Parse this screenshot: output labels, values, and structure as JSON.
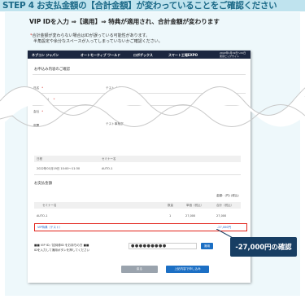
{
  "header": {
    "title": "STEP 4 お支払金額の【合計金額】が変わっていることをご確認ください",
    "bg_color": "#bfe3ee",
    "text_color": "#1c6a88"
  },
  "instruction": {
    "main": "VIP IDを入力 ⇒【適用】⇒ 特典が適用され、合計金額が変わります",
    "note_mark": "*",
    "note1": "合計金額が変わらない場合はIDが誤っている可能性があります。",
    "note2": "半角設定や余分なスペースが入ってしまっていないかご確認ください。"
  },
  "nav": {
    "items": [
      "ネプコン ジャパン",
      "オートモーティブ ワールド",
      "ロボデックス",
      "スマート工場EXPO"
    ],
    "date": "2022年1月19日～21日",
    "venue": "東京ビッグサイト"
  },
  "form": {
    "section_title": "お申込み内容のご確認",
    "rows": [
      {
        "label": "氏名",
        "required": "*",
        "value": "テスト 太郎"
      },
      {
        "label": "氏名（カナ）",
        "required": "*",
        "value": "テスト タロウ"
      },
      {
        "label": "会社",
        "required": "*",
        "value": ""
      },
      {
        "label": "部署",
        "required": "",
        "value": "テスト事業部"
      }
    ]
  },
  "seminar_table": {
    "headers": [
      "日程",
      "セミナー名"
    ],
    "row": [
      "2022年01月19日 10:00～11:30",
      "AUTO-1"
    ]
  },
  "payment": {
    "section_title": "お支払金額",
    "currency_note": "金額：(円) (税込)",
    "headers": [
      "セミナー名",
      "数量",
      "単価（税込）",
      "合計（税込）"
    ],
    "row": {
      "name": "AUTO-1",
      "qty": "1",
      "unit": "27,000",
      "total": "27,000"
    },
    "discount_row": {
      "name": "VIP特典（テスト）",
      "total": "-27,000円"
    }
  },
  "vip": {
    "label_line1": "■■ VIP ID／招待券ID をお持ちの方 ■■",
    "label_line2": "IDを入力して適用ボタンを押してください",
    "input_value": "●●●●●●●●●",
    "apply_label": "適用"
  },
  "buttons": {
    "back": "戻る",
    "submit": "上記内容で申し込み"
  },
  "callout": {
    "text": "-27,000円の確認",
    "color": "#173e63"
  },
  "colors": {
    "highlight": "#e2241b",
    "primary_button": "#1c6fc4",
    "nav_bg": "#1c2740"
  }
}
